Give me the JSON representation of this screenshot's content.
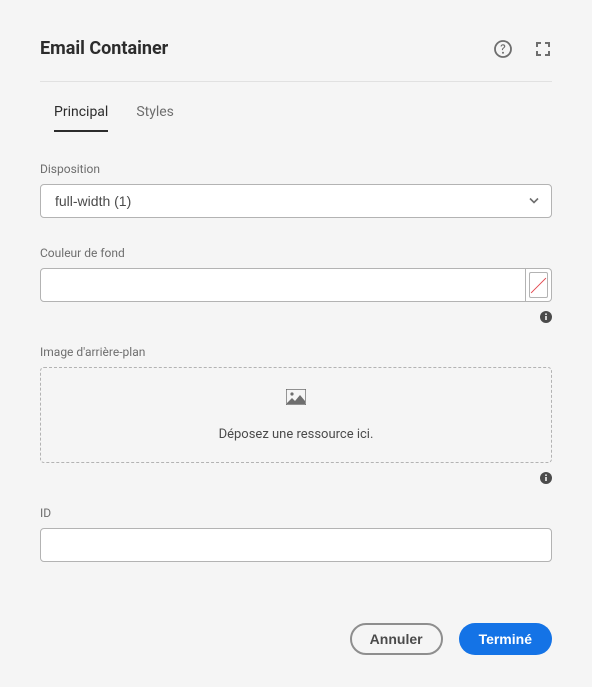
{
  "header": {
    "title": "Email Container"
  },
  "tabs": {
    "principal": "Principal",
    "styles": "Styles"
  },
  "fields": {
    "disposition": {
      "label": "Disposition",
      "value": "full-width (1)"
    },
    "bgcolor": {
      "label": "Couleur de fond",
      "value": ""
    },
    "bgimage": {
      "label": "Image d'arrière-plan",
      "drop_text": "Déposez une ressource ici."
    },
    "id": {
      "label": "ID",
      "value": ""
    }
  },
  "footer": {
    "cancel": "Annuler",
    "done": "Terminé"
  }
}
